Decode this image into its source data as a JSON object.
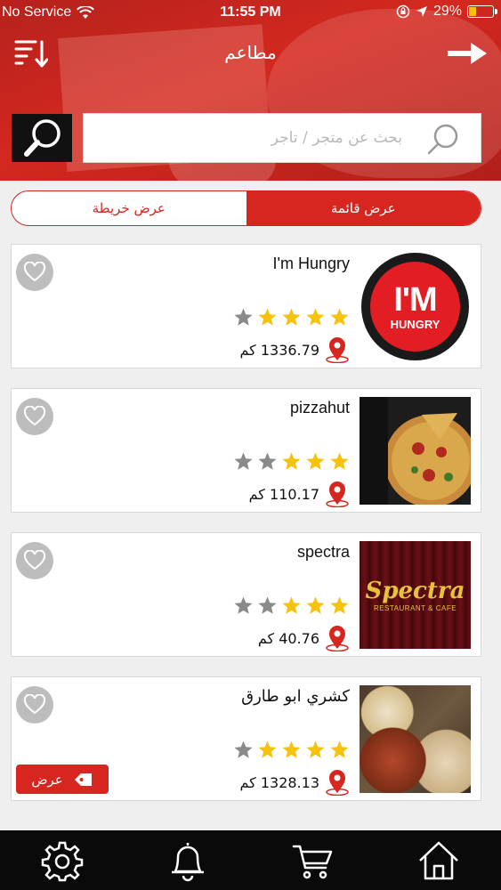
{
  "status_bar": {
    "carrier": "No Service",
    "time": "11:55 PM",
    "battery": "29%",
    "battery_level": 0.29
  },
  "header": {
    "title": "مطاعم",
    "sort_icon": "sort-descending-icon",
    "forward_icon": "arrow-right-icon"
  },
  "search": {
    "placeholder": "بحث عن متجر / تاجر",
    "value": ""
  },
  "view_toggle": {
    "list_label": "عرض قائمة",
    "map_label": "عرض خريطة",
    "selected": "list"
  },
  "stores": [
    {
      "name": "I'm Hungry",
      "rating": 4,
      "distance": "1336.79 كم",
      "offer": null,
      "thumbnail": "im-hungry-logo",
      "logo_text": [
        "I'M",
        "HUNGRY"
      ]
    },
    {
      "name": "pizzahut",
      "rating": 3,
      "distance": "110.17 كم",
      "offer": null,
      "thumbnail": "pizza-photo"
    },
    {
      "name": "spectra",
      "rating": 3,
      "distance": "40.76 كم",
      "offer": null,
      "thumbnail": "spectra-logo",
      "logo_text": [
        "Spectra",
        "RESTAURANT & CAFE"
      ]
    },
    {
      "name": "كشري ابو طارق",
      "rating": 4,
      "distance": "1328.13 كم",
      "offer": "عرض",
      "thumbnail": "food-photo"
    }
  ],
  "colors": {
    "primary": "#d6261f",
    "star_filled": "#f5c20e",
    "star_empty": "#8a8a8a",
    "tab_bar": "#0a0a0a"
  },
  "tab_bar": {
    "items": [
      {
        "icon": "gear-icon"
      },
      {
        "icon": "bell-icon"
      },
      {
        "icon": "cart-icon"
      },
      {
        "icon": "home-icon"
      }
    ]
  }
}
